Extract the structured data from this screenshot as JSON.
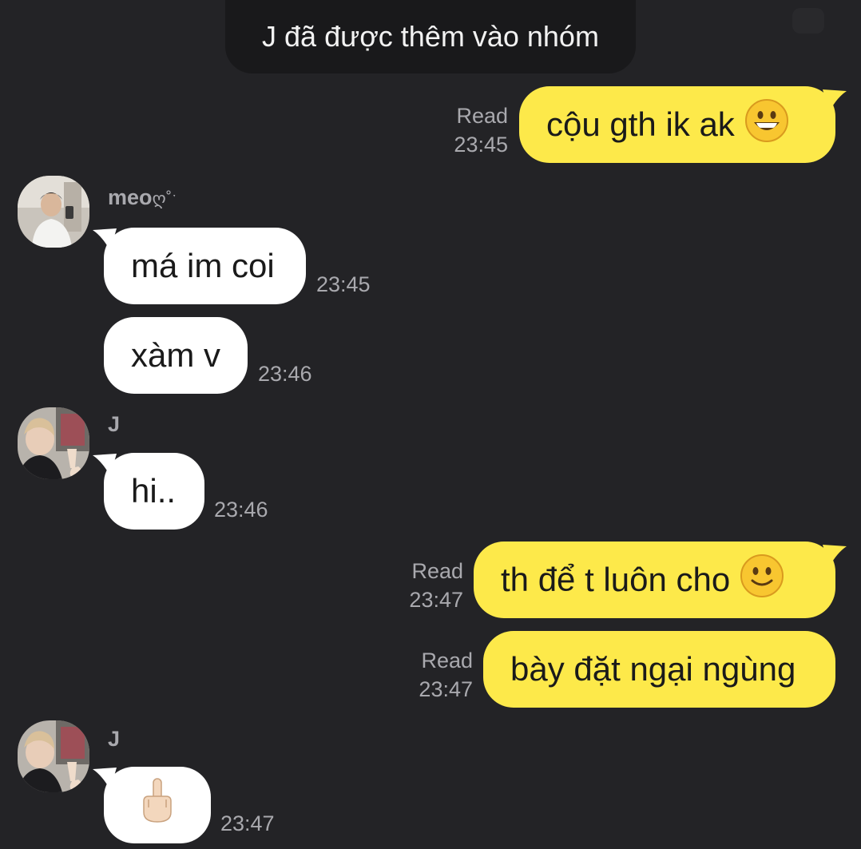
{
  "notice": {
    "text": "J đã được thêm vào nhóm"
  },
  "messages": [
    {
      "text": "cộu gth ik ak",
      "emoji": "grinning-face",
      "read": "Read",
      "time": "23:45"
    },
    {
      "sender": "meo",
      "text": "má im coi",
      "time": "23:45"
    },
    {
      "text": "xàm v",
      "time": "23:46"
    },
    {
      "sender": "J",
      "text": "hi..",
      "time": "23:46"
    },
    {
      "text": "th để t luôn cho",
      "emoji": "slightly-smiling-face",
      "read": "Read",
      "time": "23:47"
    },
    {
      "text": "bày đặt ngại ngùng",
      "read": "Read",
      "time": "23:47"
    },
    {
      "sender": "J",
      "emoji": "middle-finger",
      "time": "23:47"
    }
  ],
  "colors": {
    "background": "#232326",
    "incoming": "#ffffff",
    "outgoing": "#fde94a",
    "meta": "#a9a9ae"
  }
}
